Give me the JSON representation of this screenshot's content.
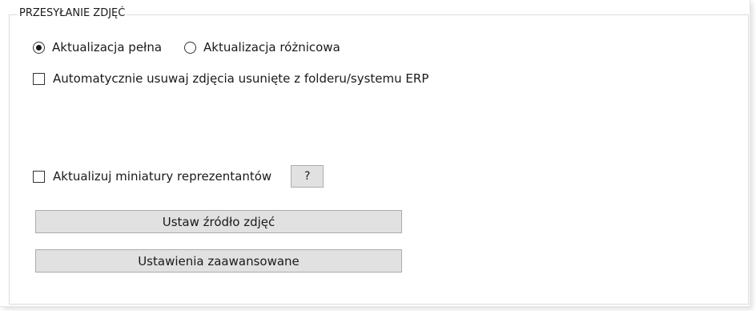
{
  "group": {
    "title": "PRZESYŁANIE ZDJĘĆ"
  },
  "update_mode": {
    "options": [
      {
        "label": "Aktualizacja pełna",
        "selected": true
      },
      {
        "label": "Aktualizacja różnicowa",
        "selected": false
      }
    ]
  },
  "auto_delete": {
    "label": "Automatycznie usuwaj zdjęcia usunięte z folderu/systemu ERP",
    "checked": false
  },
  "thumbnails": {
    "label": "Aktualizuj miniatury reprezentantów",
    "checked": false,
    "help_label": "?"
  },
  "buttons": {
    "set_source_label": "Ustaw źródło zdjęć",
    "advanced_label": "Ustawienia zaawansowane"
  }
}
